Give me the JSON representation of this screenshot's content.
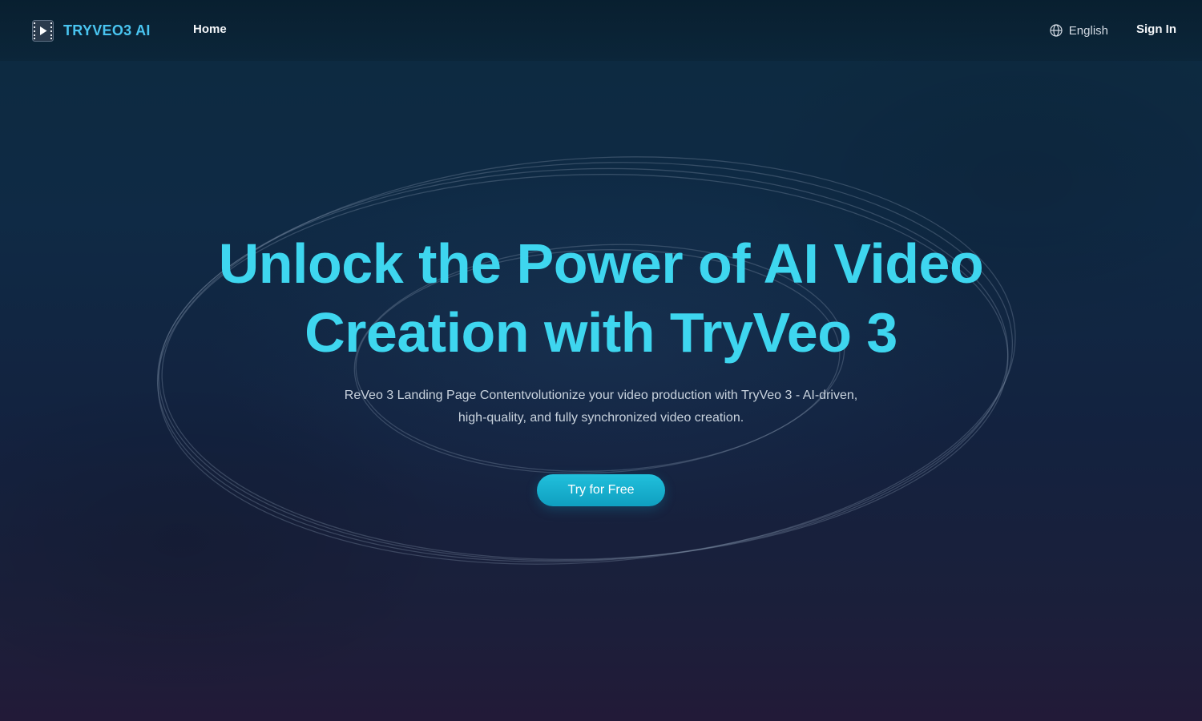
{
  "header": {
    "brand_name": "TRYVEO3 AI",
    "brand_icon": "film-play-logo-icon",
    "nav": {
      "home_label": "Home"
    },
    "language": {
      "icon": "globe-icon",
      "label": "English"
    },
    "sign_in_label": "Sign In"
  },
  "hero": {
    "title_line1": "Unlock the Power of AI Video",
    "title_line2": "Creation with TryVeo 3",
    "description": "ReVeo 3 Landing Page Contentvolutionize your video production with TryVeo 3 - AI-driven, high-quality, and fully synchronized video creation.",
    "cta_label": "Try for Free"
  },
  "colors": {
    "brand_text": "#49c4f0",
    "title": "#3ed6ef",
    "cta": "#1aafd0",
    "background_top": "#0c2a3f",
    "background_bottom": "#221a38"
  }
}
